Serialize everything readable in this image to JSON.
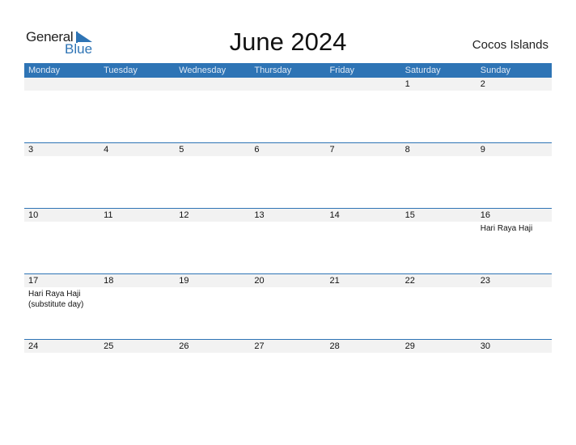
{
  "logo": {
    "general": "General",
    "blue": "Blue"
  },
  "title": "June 2024",
  "region": "Cocos Islands",
  "colors": {
    "accent": "#2e74b5",
    "band": "#f2f2f2"
  },
  "weekdays": [
    "Monday",
    "Tuesday",
    "Wednesday",
    "Thursday",
    "Friday",
    "Saturday",
    "Sunday"
  ],
  "weeks": [
    [
      {
        "day": ""
      },
      {
        "day": ""
      },
      {
        "day": ""
      },
      {
        "day": ""
      },
      {
        "day": ""
      },
      {
        "day": "1"
      },
      {
        "day": "2"
      }
    ],
    [
      {
        "day": "3"
      },
      {
        "day": "4"
      },
      {
        "day": "5"
      },
      {
        "day": "6"
      },
      {
        "day": "7"
      },
      {
        "day": "8"
      },
      {
        "day": "9"
      }
    ],
    [
      {
        "day": "10"
      },
      {
        "day": "11"
      },
      {
        "day": "12"
      },
      {
        "day": "13"
      },
      {
        "day": "14"
      },
      {
        "day": "15"
      },
      {
        "day": "16",
        "event": "Hari Raya Haji"
      }
    ],
    [
      {
        "day": "17",
        "event": "Hari Raya Haji (substitute day)"
      },
      {
        "day": "18"
      },
      {
        "day": "19"
      },
      {
        "day": "20"
      },
      {
        "day": "21"
      },
      {
        "day": "22"
      },
      {
        "day": "23"
      }
    ],
    [
      {
        "day": "24"
      },
      {
        "day": "25"
      },
      {
        "day": "26"
      },
      {
        "day": "27"
      },
      {
        "day": "28"
      },
      {
        "day": "29"
      },
      {
        "day": "30"
      }
    ]
  ]
}
